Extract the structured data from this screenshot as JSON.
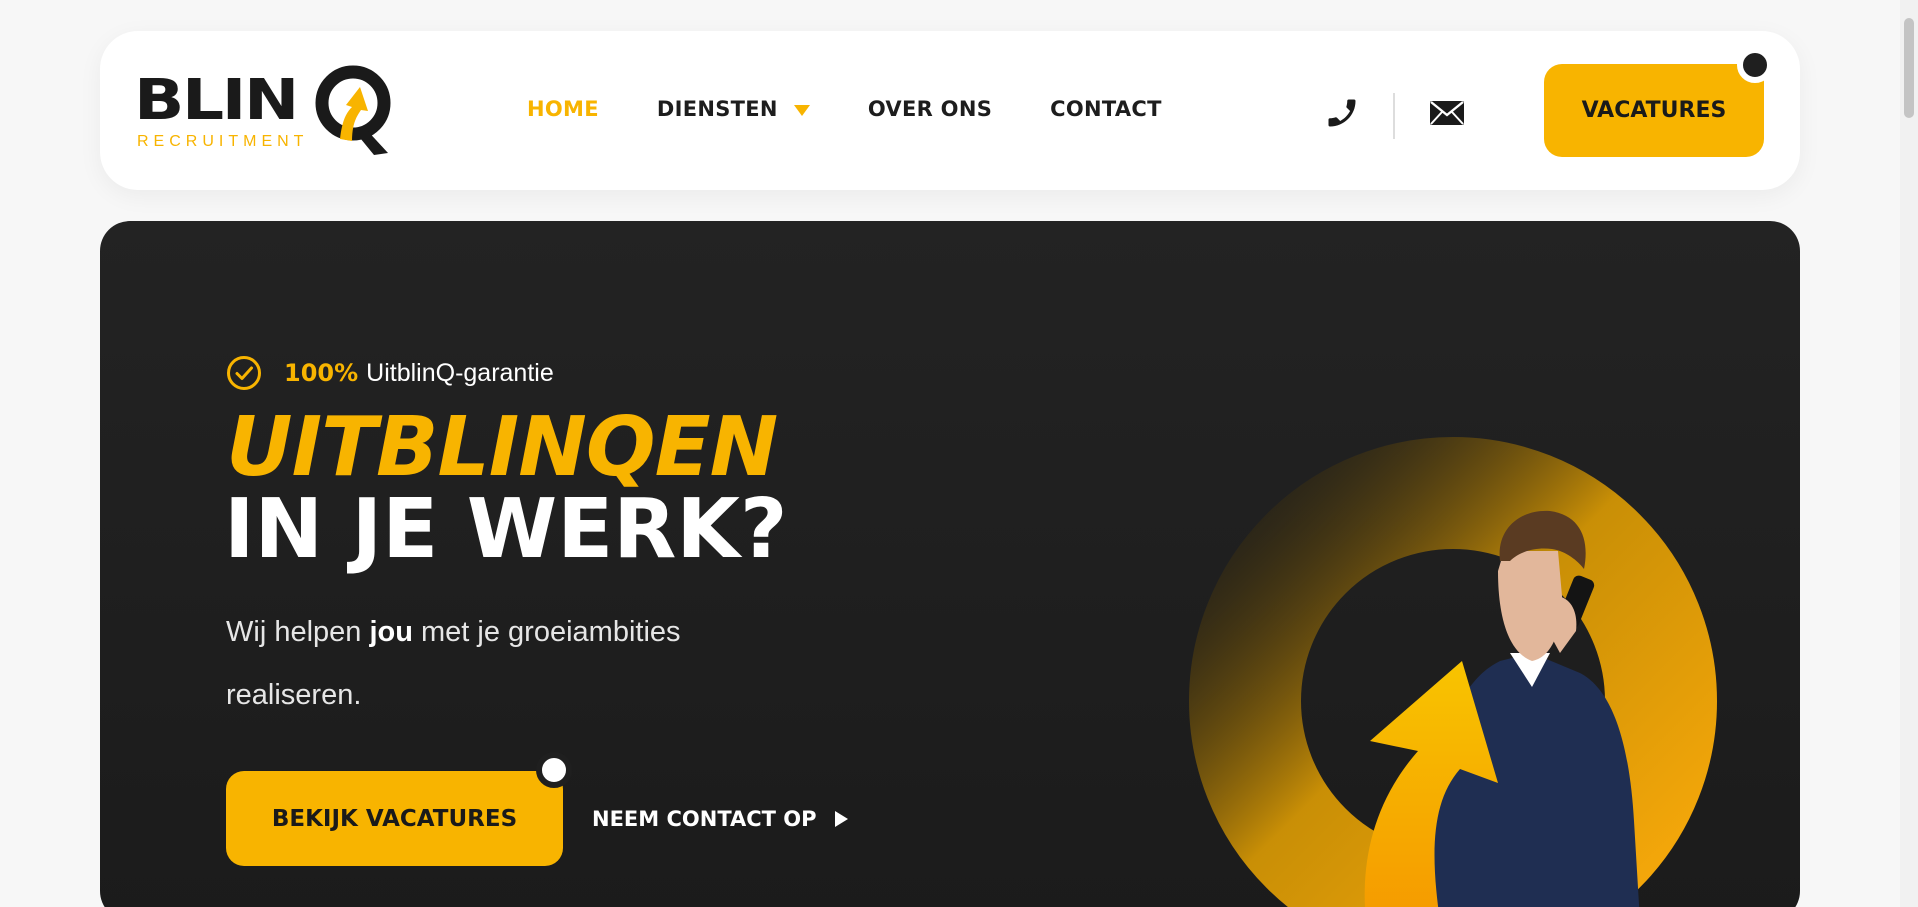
{
  "brand": {
    "logo_word": "BLIN",
    "logo_sub": "RECRUITMENT",
    "accent_color": "#f8b400",
    "dark_color": "#1f1f1f"
  },
  "nav": {
    "items": [
      {
        "label": "HOME",
        "active": true
      },
      {
        "label": "DIENSTEN",
        "active": false,
        "has_dropdown": true
      },
      {
        "label": "OVER ONS",
        "active": false
      },
      {
        "label": "CONTACT",
        "active": false
      }
    ]
  },
  "header": {
    "phone_icon": "phone-icon",
    "mail_icon": "mail-icon",
    "cta_label": "VACATURES"
  },
  "hero": {
    "guarantee_pct": "100%",
    "guarantee_text": "UitblinQ-garantie",
    "headline_1": "UITBLINQEN",
    "headline_2": "IN JE WERK?",
    "sub_prefix": "Wij helpen ",
    "sub_bold": "jou",
    "sub_suffix": " met je groeiambities realiseren.",
    "primary_cta": "BEKIJK VACATURES",
    "secondary_cta": "NEEM CONTACT OP"
  }
}
